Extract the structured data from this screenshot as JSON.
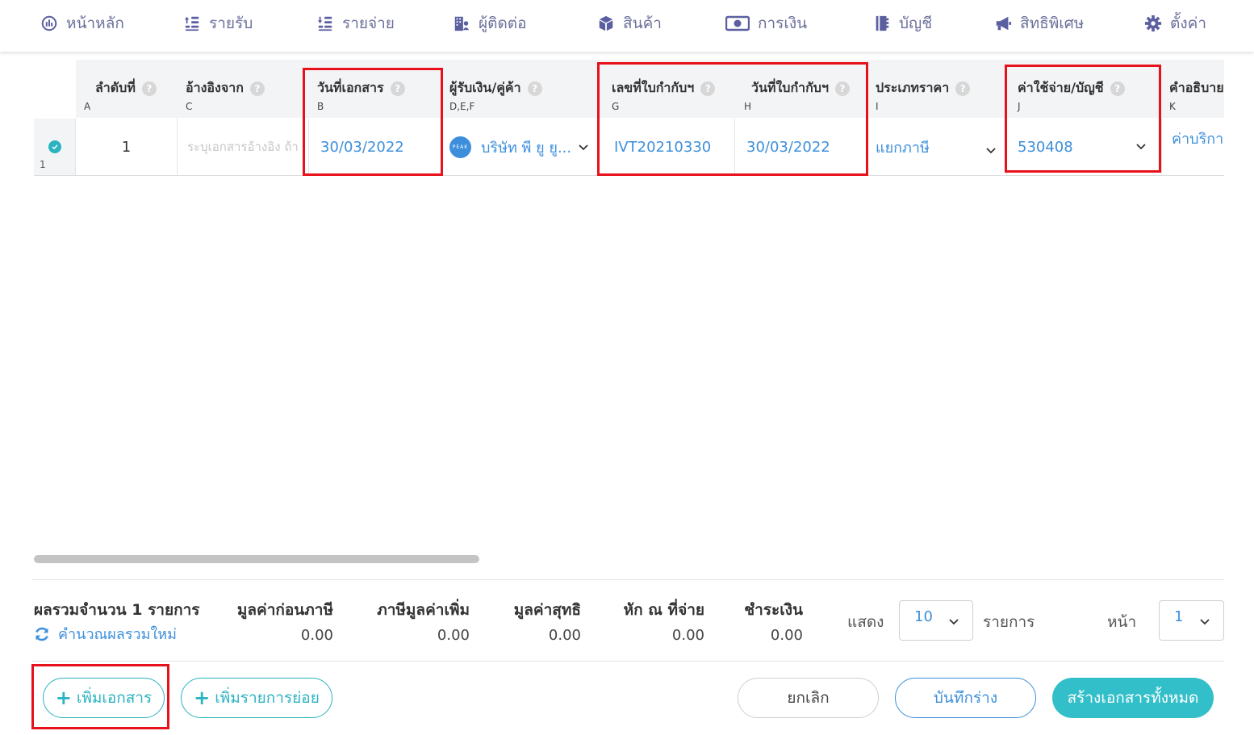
{
  "nav": {
    "items": [
      {
        "label": "หน้าหลัก",
        "icon": "dashboard-icon"
      },
      {
        "label": "รายรับ",
        "icon": "income-icon"
      },
      {
        "label": "รายจ่าย",
        "icon": "expense-icon"
      },
      {
        "label": "ผู้ติดต่อ",
        "icon": "contacts-icon"
      },
      {
        "label": "สินค้า",
        "icon": "product-box-icon"
      },
      {
        "label": "การเงิน",
        "icon": "money-icon"
      },
      {
        "label": "บัญชี",
        "icon": "ledger-book-icon"
      },
      {
        "label": "สิทธิพิเศษ",
        "icon": "megaphone-icon"
      },
      {
        "label": "ตั้งค่า",
        "icon": "gear-icon"
      }
    ]
  },
  "grid": {
    "columns": [
      {
        "title": "ลำดับที่",
        "letter": "A"
      },
      {
        "title": "อ้างอิงจาก",
        "letter": "C"
      },
      {
        "title": "วันที่เอกสาร",
        "letter": "B"
      },
      {
        "title": "ผู้รับเงิน/คู่ค้า",
        "letter": "D,E,F"
      },
      {
        "title": "เลขที่ใบกำกับฯ",
        "letter": "G"
      },
      {
        "title": "วันที่ใบกำกับฯ",
        "letter": "H"
      },
      {
        "title": "ประเภทราคา",
        "letter": "I"
      },
      {
        "title": "ค่าใช้จ่าย/บัญชี",
        "letter": "J"
      },
      {
        "title": "คำอธิบาย",
        "letter": "K"
      }
    ],
    "row": {
      "row_number": "1",
      "index": "1",
      "reference_placeholder": "ระบุเอกสารอ้างอิง ถ้ามี",
      "doc_date": "30/03/2022",
      "peak_logo_text": "PEAK",
      "payee": "บริษัท พี ยู ยู...",
      "invoice_no": "IVT20210330",
      "invoice_date": "30/03/2022",
      "price_type": "แยกภาษี",
      "account": "530408",
      "description": "ค่าบริการ"
    }
  },
  "summary": {
    "title": "ผลรวมจำนวน 1 รายการ",
    "recalc": "คำนวณผลรวมใหม่",
    "cols": [
      {
        "title": "มูลค่าก่อนภาษี",
        "value": "0.00"
      },
      {
        "title": "ภาษีมูลค่าเพิ่ม",
        "value": "0.00"
      },
      {
        "title": "มูลค่าสุทธิ",
        "value": "0.00"
      },
      {
        "title": "หัก ณ ที่จ่าย",
        "value": "0.00"
      },
      {
        "title": "ชำระเงิน",
        "value": "0.00"
      }
    ],
    "show_label": "แสดง",
    "page_size": "10",
    "items_label": "รายการ",
    "page_label": "หน้า",
    "page": "1"
  },
  "actions": {
    "add_doc": "เพิ่มเอกสาร",
    "add_subitem": "เพิ่มรายการย่อย",
    "cancel": "ยกเลิก",
    "save_draft": "บันทึกร่าง",
    "create_all": "สร้างเอกสารทั้งหมด"
  },
  "colors": {
    "accent_teal": "#33bfc9",
    "link_blue": "#3d8fdc",
    "highlight_red": "#e8101a",
    "nav_text": "#6b6f9a"
  }
}
